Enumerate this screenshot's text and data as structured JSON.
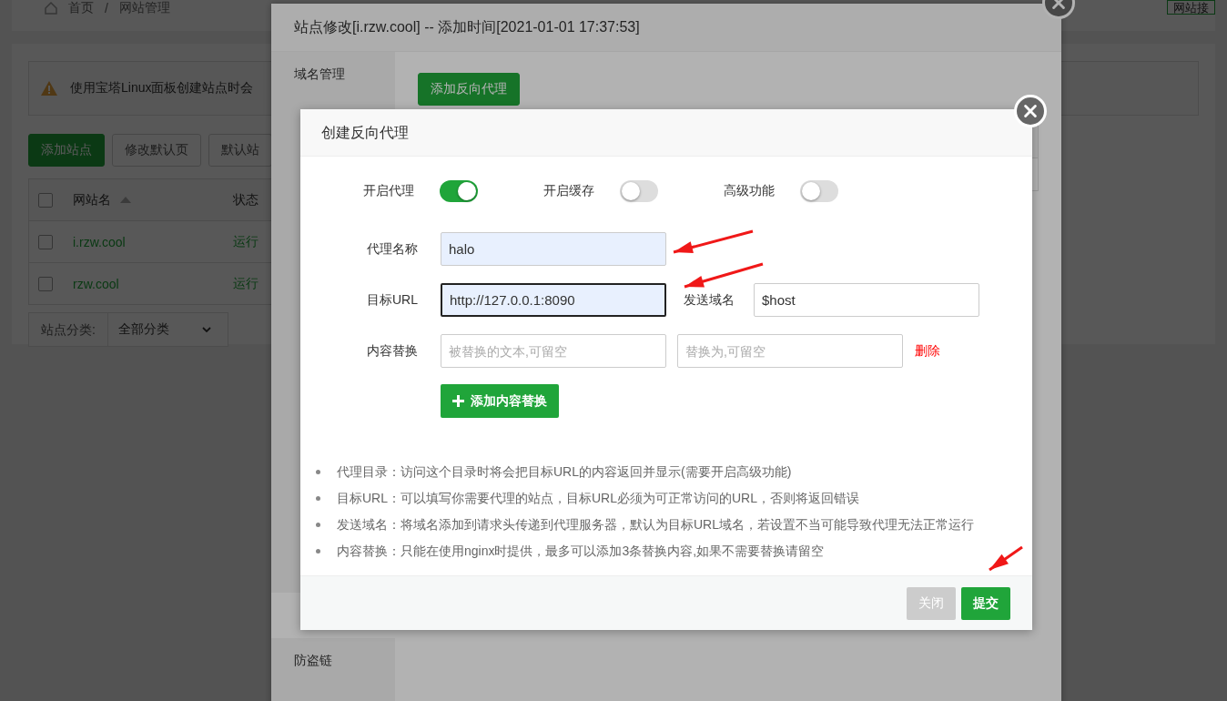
{
  "breadcrumb": {
    "home": "首页",
    "separator": "/",
    "current": "网站管理"
  },
  "top_right_button": "网站接",
  "notice": "使用宝塔Linux面板创建站点时会",
  "toolbar_buttons": [
    {
      "label": "添加站点",
      "kind": "primary"
    },
    {
      "label": "修改默认页",
      "kind": "default"
    },
    {
      "label": "默认站",
      "kind": "default"
    }
  ],
  "table": {
    "select_all_checked": false,
    "columns": [
      "网站名",
      "状态"
    ],
    "rows": [
      {
        "name": "i.rzw.cool",
        "status": "运行",
        "checked": false
      },
      {
        "name": "rzw.cool",
        "status": "运行",
        "checked": false
      }
    ]
  },
  "category": {
    "label": "站点分类:",
    "value": "全部分类"
  },
  "site_dialog": {
    "title": "站点修改[i.rzw.cool] -- 添加时间[2021-01-01 17:37:53]",
    "menu": [
      {
        "label": "域名管理"
      },
      {
        "label": "防盗链"
      }
    ],
    "add_button": "添加反向代理"
  },
  "proxy_dialog": {
    "title": "创建反向代理",
    "switches": [
      {
        "label": "开启代理",
        "on": true
      },
      {
        "label": "开启缓存",
        "on": false
      },
      {
        "label": "高级功能",
        "on": false
      }
    ],
    "name": {
      "label": "代理名称",
      "value": "halo",
      "focused": false
    },
    "target": {
      "label": "目标URL",
      "value": "http://127.0.0.1:8090",
      "focused": true
    },
    "host": {
      "label": "发送域名",
      "value": "$host"
    },
    "replace": {
      "label": "内容替换",
      "fields": [
        {
          "placeholder": "被替换的文本,可留空"
        },
        {
          "placeholder": "替换为,可留空"
        }
      ],
      "delete": "删除"
    },
    "add_replace_button": "添加内容替换",
    "notes": [
      "代理目录：访问这个目录时将会把目标URL的内容返回并显示(需要开启高级功能)",
      "目标URL：可以填写你需要代理的站点，目标URL必须为可正常访问的URL，否则将返回错误",
      "发送域名：将域名添加到请求头传递到代理服务器，默认为目标URL域名，若设置不当可能导致代理无法正常运行",
      "内容替换：只能在使用nginx时提供，最多可以添加3条替换内容,如果不需要替换请留空"
    ],
    "buttons": [
      {
        "label": "关闭",
        "kind": "secondary"
      },
      {
        "label": "提交",
        "kind": "primary"
      }
    ]
  }
}
